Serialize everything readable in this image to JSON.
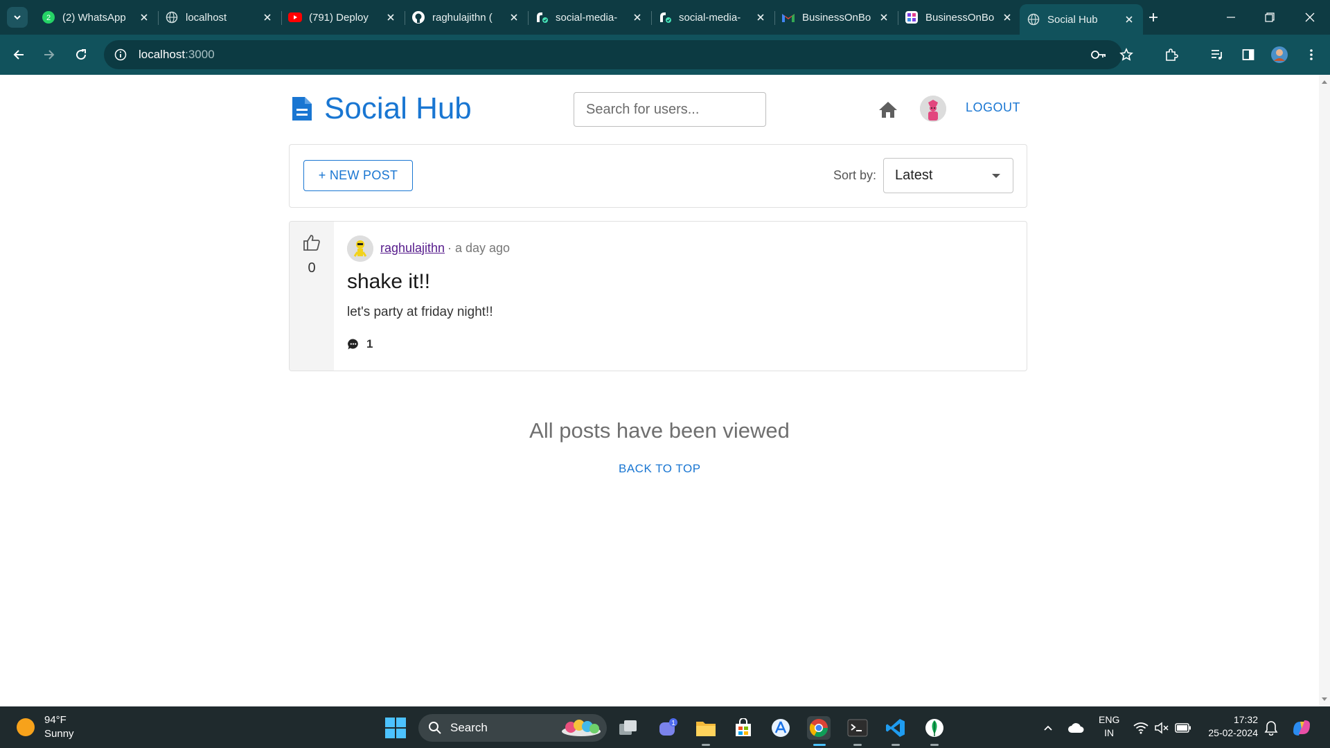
{
  "browser": {
    "tabs": [
      {
        "title": "(2) WhatsApp",
        "icon": "whatsapp-icon"
      },
      {
        "title": "localhost",
        "icon": "globe-icon"
      },
      {
        "title": "(791) Deploy",
        "icon": "youtube-icon"
      },
      {
        "title": "raghulajithn (",
        "icon": "github-icon"
      },
      {
        "title": "social-media-",
        "icon": "render-icon"
      },
      {
        "title": "social-media-",
        "icon": "render-icon"
      },
      {
        "title": "BusinessOnBo",
        "icon": "gmail-icon"
      },
      {
        "title": "BusinessOnBo",
        "icon": "app-icon"
      },
      {
        "title": "Social Hub",
        "icon": "globe-icon",
        "active": true
      }
    ],
    "url_host": "localhost",
    "url_port": ":3000",
    "whatsapp_badge": "2"
  },
  "header": {
    "brand": "Social Hub",
    "search_placeholder": "Search for users...",
    "logout_label": "LOGOUT"
  },
  "toolbar": {
    "new_post_label": "+ NEW POST",
    "sort_label": "Sort by:",
    "sort_value": "Latest"
  },
  "post": {
    "likes": "0",
    "author": "raghulajithn",
    "meta": "· a day ago",
    "title": "shake it!!",
    "body": "let's party at friday night!!",
    "comment_count": "1"
  },
  "feed_end": {
    "message": "All posts have been viewed",
    "back_to_top": "BACK TO TOP"
  },
  "taskbar": {
    "temperature": "94°F",
    "condition": "Sunny",
    "search_label": "Search",
    "lang_line1": "ENG",
    "lang_line2": "IN",
    "time": "17:32",
    "date": "25-02-2024",
    "chat_badge": "1"
  },
  "colors": {
    "brand": "#1976d2",
    "tabstrip": "#0e3b43",
    "toolbar": "#11525c",
    "taskbar": "#1f2a2d"
  }
}
